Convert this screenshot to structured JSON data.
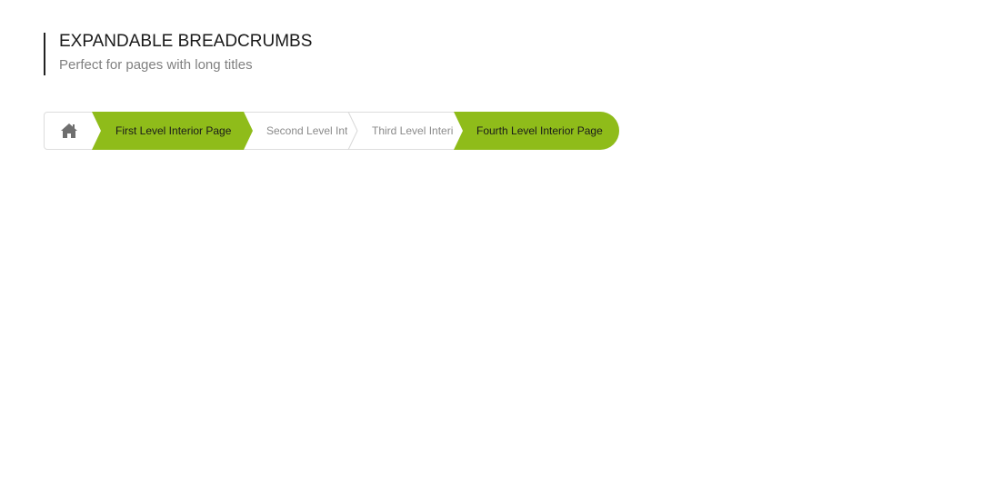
{
  "header": {
    "title": "EXPANDABLE BREADCRUMBS",
    "subtitle": "Perfect for pages with long titles"
  },
  "breadcrumbs": {
    "home_icon": "home-icon",
    "accent_color": "#8fbc1a",
    "items": [
      {
        "label": "First Level Interior Page",
        "active": true
      },
      {
        "label": "Second Level Int",
        "active": false
      },
      {
        "label": "Third Level Interi",
        "active": false
      },
      {
        "label": "Fourth Level Interior Page",
        "active": true
      }
    ]
  }
}
